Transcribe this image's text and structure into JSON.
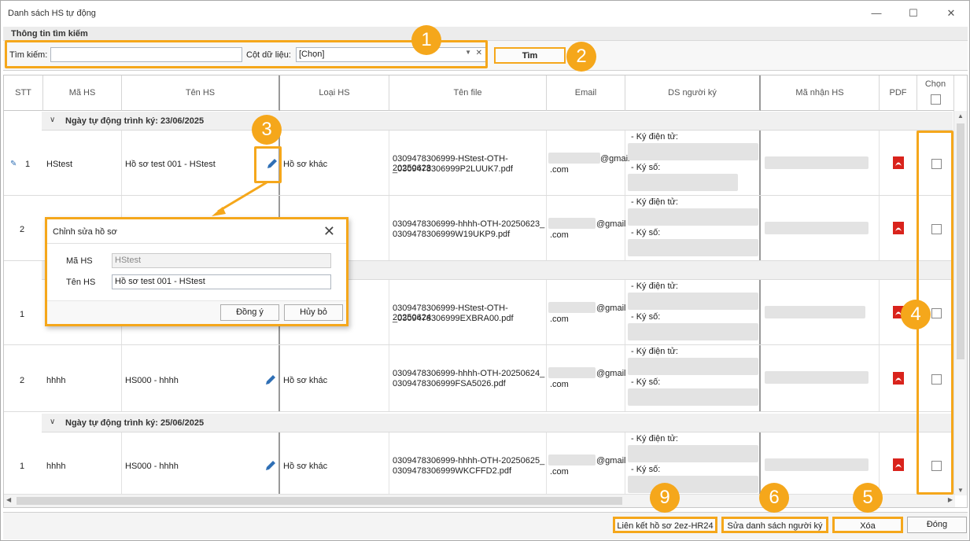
{
  "window": {
    "title": "Danh sách HS tự động"
  },
  "search_panel": {
    "header": "Thông tin tìm kiếm",
    "search_label": "Tìm kiếm:",
    "search_value": "",
    "column_label": "Cột dữ liệu:",
    "column_value": "[Chọn]",
    "find_button": "Tìm"
  },
  "grid": {
    "columns": [
      "STT",
      "Mã HS",
      "Tên HS",
      "Loại HS",
      "Tên file",
      "Email",
      "DS người ký",
      "Mã nhận HS",
      "PDF",
      "Chọn"
    ],
    "groups": [
      {
        "label": "Ngày tự động trình ký: 23/06/2025"
      },
      {
        "label": "Ngày tự động trình ký: 25/06/2025"
      }
    ],
    "rows": [
      {
        "stt": "1",
        "ma": "HStest",
        "ten": "Hồ sơ test 001 - HStest",
        "loai": "Hồ sơ khác",
        "file1": "0309478306999-HStest-OTH-20250623",
        "file2": "_0309478306999P2LUUK7.pdf",
        "email_domain": "@gmail",
        "email_tld": ".com",
        "ky_dt": "- Ký điện tử:",
        "ky_so": "- Ký số:"
      },
      {
        "stt": "2",
        "ma": "",
        "ten": "",
        "loai": "",
        "file1": "0309478306999-hhhh-OTH-20250623_",
        "file2": "0309478306999W19UKP9.pdf",
        "email_domain": "@gmail",
        "email_tld": ".com",
        "ky_dt": "- Ký điện tử:",
        "ky_so": "- Ký số:"
      },
      {
        "stt": "1",
        "ma": "",
        "ten": "",
        "loai": "",
        "file1": "0309478306999-HStest-OTH-20250624",
        "file2": "_0309478306999EXBRA00.pdf",
        "email_domain": "@gmail",
        "email_tld": ".com",
        "ky_dt": "- Ký điện tử:",
        "ky_so": "- Ký số:"
      },
      {
        "stt": "2",
        "ma": "hhhh",
        "ten": "HS000 - hhhh",
        "loai": "Hồ sơ khác",
        "file1": "0309478306999-hhhh-OTH-20250624_",
        "file2": "0309478306999FSA5026.pdf",
        "email_domain": "@gmail",
        "email_tld": ".com",
        "ky_dt": "- Ký điện tử:",
        "ky_so": "- Ký số:"
      },
      {
        "stt": "1",
        "ma": "hhhh",
        "ten": "HS000 - hhhh",
        "loai": "Hồ sơ khác",
        "file1": "0309478306999-hhhh-OTH-20250625_",
        "file2": "0309478306999WKCFFD2.pdf",
        "email_domain": "@gmail",
        "email_tld": ".com",
        "ky_dt": "- Ký điện tử:",
        "ky_so": "- Ký số:"
      }
    ]
  },
  "dialog": {
    "title": "Chỉnh sửa hồ sơ",
    "ma_label": "Mã HS",
    "ma_value": "HStest",
    "ten_label": "Tên HS",
    "ten_value": "Hồ sơ test 001 - HStest",
    "ok": "Đồng ý",
    "cancel": "Hủy bỏ"
  },
  "bottom": {
    "link_button": "Liên kết hồ sơ 2ez-HR24",
    "edit_signers_button": "Sửa danh sách người ký",
    "delete_button": "Xóa",
    "close_button": "Đóng"
  },
  "badges": [
    "1",
    "2",
    "3",
    "4",
    "5",
    "6",
    "9"
  ],
  "colors": {
    "accent": "#f5a71b",
    "pdf_red": "#d9231c",
    "pencil_blue": "#2f6fb5"
  },
  "icons": {
    "pencil": "pencil-icon",
    "pdf": "pdf-icon",
    "close": "close-icon",
    "chevron": "chevron-down-icon"
  }
}
